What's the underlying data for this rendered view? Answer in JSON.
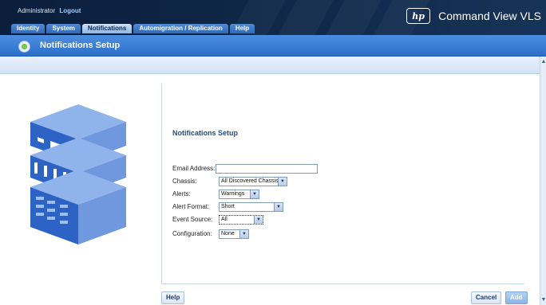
{
  "header": {
    "user": "Administrator",
    "logout": "Logout",
    "app_title": "Command View VLS",
    "logo_text": "hp"
  },
  "tabs": [
    "Identity",
    "System",
    "Notifications",
    "Automigration / Replication",
    "Help"
  ],
  "active_tab": "Notifications",
  "page_title": "Notifications Setup",
  "form": {
    "title": "Notifications Setup",
    "email_label": "Email Address:",
    "email_value": "",
    "chassis_label": "Chassis:",
    "chassis_value": "All Discovered Chassis",
    "alerts_label": "Alerts:",
    "alerts_value": "Warnings",
    "alert_format_label": "Alert Format:",
    "alert_format_value": "Short",
    "event_source_label": "Event Source:",
    "event_source_value": "All",
    "configuration_label": "Configuration:",
    "configuration_value": "None"
  },
  "buttons": {
    "help": "Help",
    "cancel": "Cancel",
    "add": "Add"
  },
  "colors": {
    "header_bg": "#10284a",
    "title_bar": "#3a7fd6",
    "accent_link": "#9fd0ff"
  }
}
